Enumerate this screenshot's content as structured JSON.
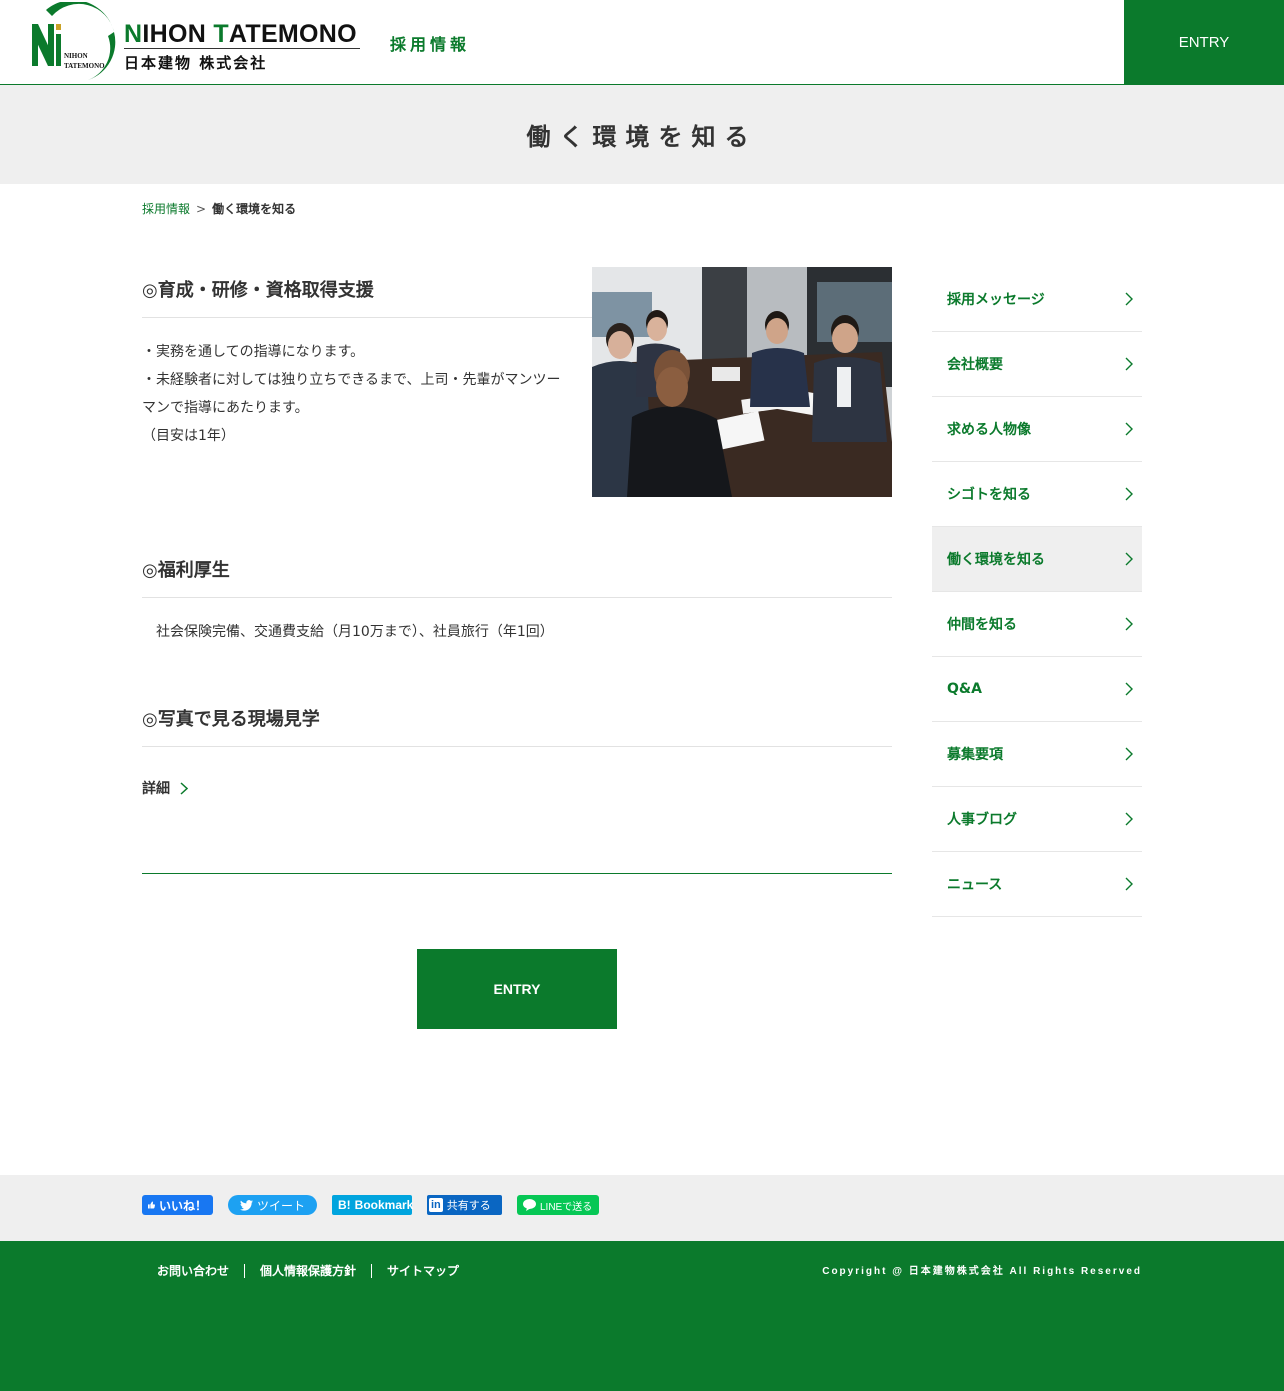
{
  "header": {
    "logo_en_initials": "N",
    "logo_en_part1": "IHON ",
    "logo_en_initial2": "T",
    "logo_en_part2": "ATEMONO",
    "logo_ja": "日本建物 株式会社",
    "logo_mark_top": "NIHON",
    "logo_mark_bottom": "TATEMONO",
    "recruit_title": "採用情報",
    "entry_label": "ENTRY"
  },
  "page_title": "働く環境を知る",
  "breadcrumb": {
    "home": "採用情報",
    "separator": ">",
    "current": "働く環境を知る"
  },
  "sections": [
    {
      "heading": "◎育成・研修・資格取得支援",
      "lines": [
        "・実務を通しての指導になります。",
        "・未経験者に対しては独り立ちできるまで、上司・先輩がマンツー",
        "マンで指導にあたります。",
        "（目安は1年）"
      ]
    },
    {
      "heading": "◎福利厚生",
      "text": "社会保険完備、交通費支給（月10万まで）、社員旅行（年1回）"
    },
    {
      "heading": "◎写真で見る現場見学",
      "link_label": "詳細"
    }
  ],
  "entry_button": "ENTRY",
  "sidenav": [
    {
      "label": "採用メッセージ",
      "active": false
    },
    {
      "label": "会社概要",
      "active": false
    },
    {
      "label": "求める人物像",
      "active": false
    },
    {
      "label": "シゴトを知る",
      "active": false
    },
    {
      "label": "働く環境を知る",
      "active": true
    },
    {
      "label": "仲間を知る",
      "active": false
    },
    {
      "label": "Q&A",
      "active": false
    },
    {
      "label": "募集要項",
      "active": false
    },
    {
      "label": "人事ブログ",
      "active": false
    },
    {
      "label": "ニュース",
      "active": false
    }
  ],
  "share": {
    "facebook": "いいね！",
    "twitter": "ツイート",
    "hatena_mark": "B!",
    "hatena": "Bookmark",
    "linkedin_mark": "in",
    "linkedin": "共有する",
    "line": "LINEで送る"
  },
  "footer": {
    "links": [
      "お問い合わせ",
      "個人情報保護方針",
      "サイトマップ"
    ],
    "copyright": "Copyright @ 日本建物株式会社 All Rights Reserved"
  },
  "colors": {
    "brand_green": "#0b7a2c",
    "light_gray": "#efefef",
    "facebook": "#1877f2",
    "twitter": "#1da1f2",
    "hatena": "#00a4de",
    "linkedin": "#0a66c2",
    "line": "#06c755"
  }
}
